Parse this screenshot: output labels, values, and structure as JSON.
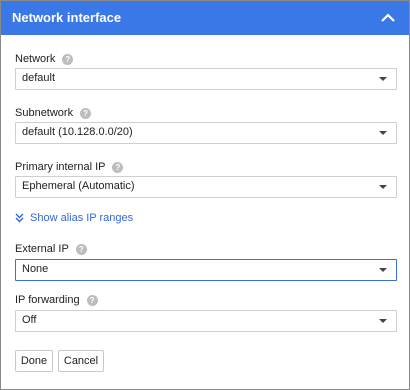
{
  "header": {
    "title": "Network interface"
  },
  "fields": {
    "network": {
      "label": "Network",
      "value": "default"
    },
    "subnetwork": {
      "label": "Subnetwork",
      "value": "default (10.128.0.0/20)"
    },
    "primary_ip": {
      "label": "Primary internal IP",
      "value": "Ephemeral (Automatic)"
    },
    "external_ip": {
      "label": "External IP",
      "value": "None"
    },
    "ip_forwarding": {
      "label": "IP forwarding",
      "value": "Off"
    }
  },
  "alias_link": {
    "label": "Show alias IP ranges"
  },
  "buttons": {
    "done": "Done",
    "cancel": "Cancel"
  },
  "help_glyph": "?",
  "colors": {
    "header_bg": "#3b78e7",
    "link": "#3367d6",
    "focus_border": "#3b6fd6"
  },
  "icons": {
    "collapse": "chevron-up-icon",
    "help": "help-icon",
    "expand": "double-chevron-down-icon",
    "dropdown": "caret-down-icon"
  }
}
